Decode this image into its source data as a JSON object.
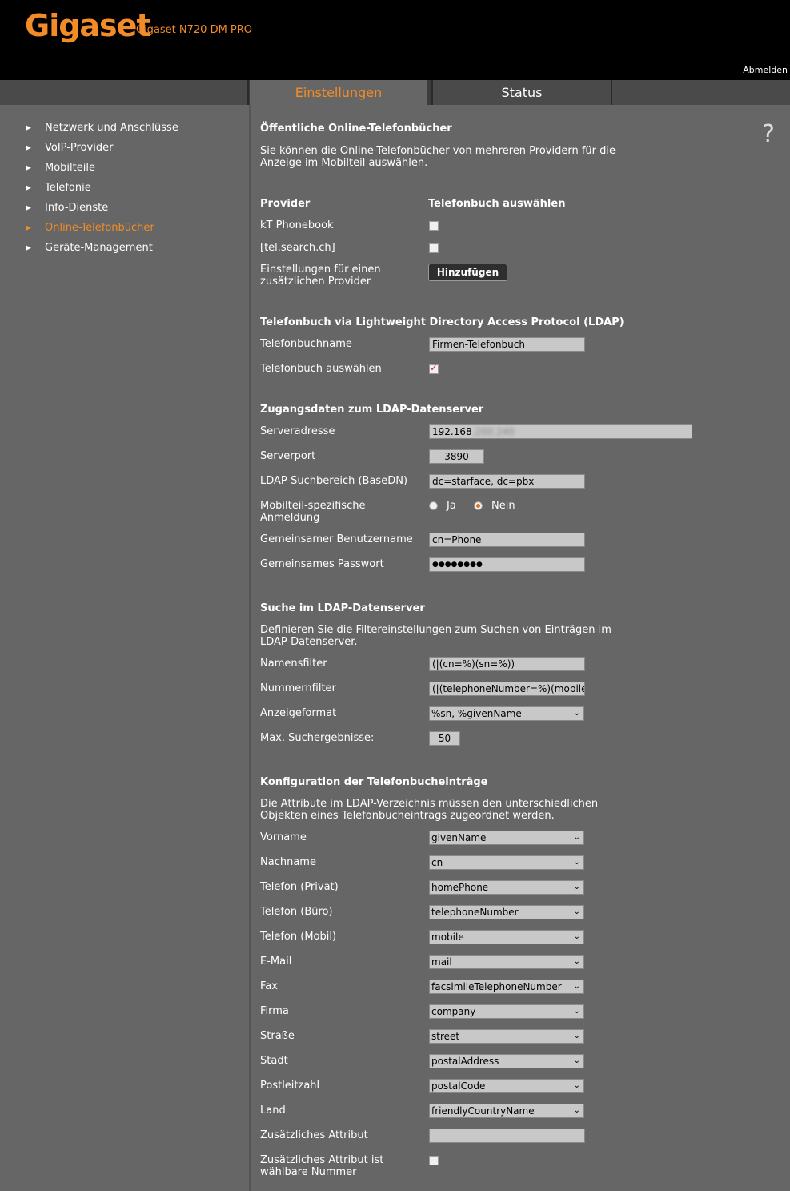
{
  "header": {
    "logo": "Gigaset",
    "model": "Gigaset N720 DM PRO",
    "logout": "Abmelden"
  },
  "tabs": {
    "einstellungen": "Einstellungen",
    "status": "Status"
  },
  "help": "?",
  "sidebar": {
    "items": [
      {
        "label": "Netzwerk und Anschlüsse"
      },
      {
        "label": "VoIP-Provider"
      },
      {
        "label": "Mobilteile"
      },
      {
        "label": "Telefonie"
      },
      {
        "label": "Info-Dienste"
      },
      {
        "label": "Online-Telefonbücher",
        "active": true
      },
      {
        "label": "Geräte-Management"
      }
    ],
    "arrow": "▶"
  },
  "public": {
    "title": "Öffentliche Online-Telefonbücher",
    "desc1": "Sie können die Online-Telefonbücher von mehreren Providern für die",
    "desc2": "Anzeige im Mobilteil auswählen.",
    "col_provider": "Provider",
    "col_select": "Telefonbuch auswählen",
    "provider1": "kT Phonebook",
    "provider2": "[tel.search.ch]",
    "additional1": "Einstellungen für einen",
    "additional2": "zusätzlichen Provider",
    "add_button": "Hinzufügen"
  },
  "ldap": {
    "title": "Telefonbuch via Lightweight Directory Access Protocol (LDAP)",
    "name_label": "Telefonbuchname",
    "name_value": "Firmen-Telefonbuch",
    "select_label": "Telefonbuch auswählen"
  },
  "access": {
    "title": "Zugangsdaten zum LDAP-Datenserver",
    "server_label": "Serveradresse",
    "server_value": "192.168",
    "server_blur": ".200.240",
    "port_label": "Serverport",
    "port_value": "3890",
    "basedn_label": "LDAP-Suchbereich (BaseDN)",
    "basedn_value": "dc=starface, dc=pbx",
    "login_label1": "Mobilteil-spezifische",
    "login_label2": "Anmeldung",
    "ja": "Ja",
    "nein": "Nein",
    "user_label": "Gemeinsamer Benutzername",
    "user_value": "cn=Phone",
    "pass_label": "Gemeinsames Passwort",
    "pass_value": "●●●●●●●●"
  },
  "search": {
    "title": "Suche im LDAP-Datenserver",
    "desc1": "Definieren Sie die Filtereinstellungen zum Suchen von Einträgen im",
    "desc2": "LDAP-Datenserver.",
    "name_filter_label": "Namensfilter",
    "name_filter_value": "(|(cn=%)(sn=%))",
    "number_filter_label": "Nummernfilter",
    "number_filter_value": "(|(telephoneNumber=%)(mobile=",
    "format_label": "Anzeigeformat",
    "format_value": "%sn, %givenName",
    "max_label": "Max. Suchergebnisse:",
    "max_value": "50"
  },
  "config": {
    "title": "Konfiguration der Telefonbucheinträge",
    "desc1": "Die Attribute im LDAP-Verzeichnis müssen den unterschiedlichen",
    "desc2": "Objekten eines Telefonbucheintrags zugeordnet werden.",
    "fields": [
      {
        "label": "Vorname",
        "value": "givenName"
      },
      {
        "label": "Nachname",
        "value": "cn"
      },
      {
        "label": "Telefon (Privat)",
        "value": "homePhone"
      },
      {
        "label": "Telefon (Büro)",
        "value": "telephoneNumber"
      },
      {
        "label": "Telefon (Mobil)",
        "value": "mobile"
      },
      {
        "label": "E-Mail",
        "value": "mail"
      },
      {
        "label": "Fax",
        "value": "facsimileTelephoneNumber"
      },
      {
        "label": "Firma",
        "value": "company"
      },
      {
        "label": "Straße",
        "value": "street"
      },
      {
        "label": "Stadt",
        "value": "postalAddress"
      },
      {
        "label": "Postleitzahl",
        "value": "postalCode"
      },
      {
        "label": "Land",
        "value": "friendlyCountryName"
      }
    ],
    "extra_label": "Zusätzliches Attribut",
    "extra_value": "",
    "extra_dial_label1": "Zusätzliches Attribut ist",
    "extra_dial_label2": "wählbare Nummer"
  },
  "chevron": "⌄"
}
